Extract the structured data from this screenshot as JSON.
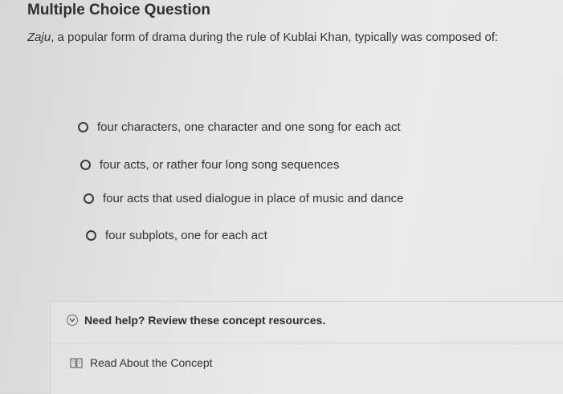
{
  "page": {
    "title": "Multiple Choice Question"
  },
  "question": {
    "term": "Zaju",
    "text": ", a popular form of drama during the rule of Kublai Khan, typically was composed of:"
  },
  "options": [
    {
      "label": "four characters, one character and one song for each act",
      "selected": false
    },
    {
      "label": "four acts, or rather four long song sequences",
      "selected": false
    },
    {
      "label": "four acts that used dialogue in place of music and dance",
      "selected": false
    },
    {
      "label": "four subplots, one for each act",
      "selected": false
    }
  ],
  "help": {
    "title": "Need help? Review these concept resources.",
    "icon": "chevron-down-icon",
    "resources": [
      {
        "label": "Read About the Concept",
        "icon": "book-icon"
      }
    ]
  }
}
